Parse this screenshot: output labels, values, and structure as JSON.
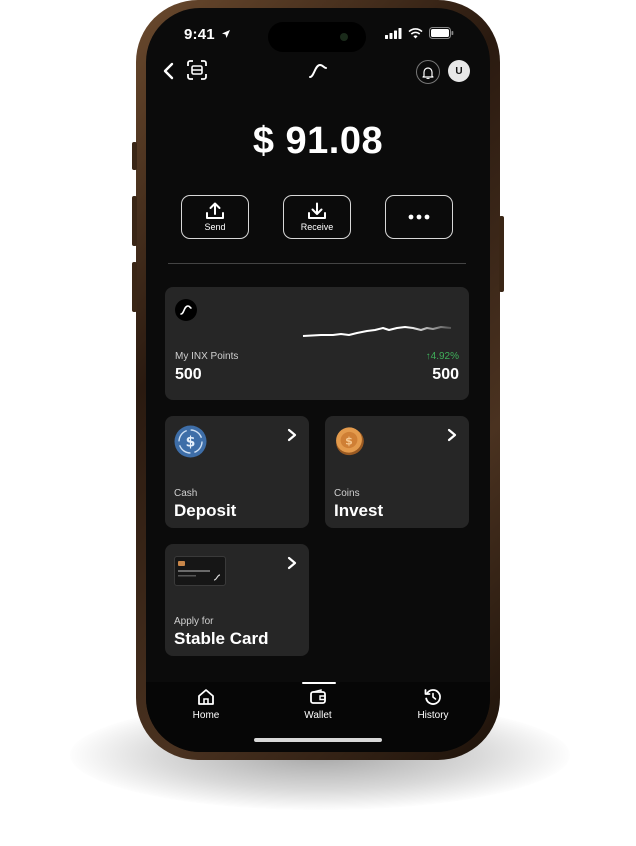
{
  "status": {
    "time": "9:41"
  },
  "header": {
    "back_icon": "chevron-left-icon",
    "scan_icon": "scan-icon",
    "logo_icon": "inx-logo-icon",
    "bell_icon": "bell-icon",
    "avatar_initial": "U"
  },
  "balance": {
    "amount": "$ 91.08"
  },
  "actions": [
    {
      "label": "Send",
      "icon": "upload-icon"
    },
    {
      "label": "Receive",
      "icon": "download-icon"
    },
    {
      "label": "",
      "icon": "more-icon"
    }
  ],
  "points_card": {
    "label": "My INX Points",
    "value": "500",
    "change": "↑4.92%",
    "change_color": "#3fae5a",
    "right_value": "500"
  },
  "tiles": {
    "deposit": {
      "sub": "Cash",
      "title": "Deposit",
      "icon": "usdc-coin-icon"
    },
    "invest": {
      "sub": "Coins",
      "title": "Invest",
      "icon": "gold-coin-icon"
    },
    "card": {
      "sub": "Apply for",
      "title": "Stable Card",
      "icon": "credit-card-icon"
    }
  },
  "nav": {
    "items": [
      {
        "label": "Home",
        "icon": "home-icon"
      },
      {
        "label": "Wallet",
        "icon": "wallet-icon"
      },
      {
        "label": "History",
        "icon": "history-icon"
      }
    ],
    "active": "Wallet"
  },
  "colors": {
    "screen_bg": "#0b0b0b",
    "card_bg": "#262626",
    "accent_green": "#3fae5a"
  }
}
